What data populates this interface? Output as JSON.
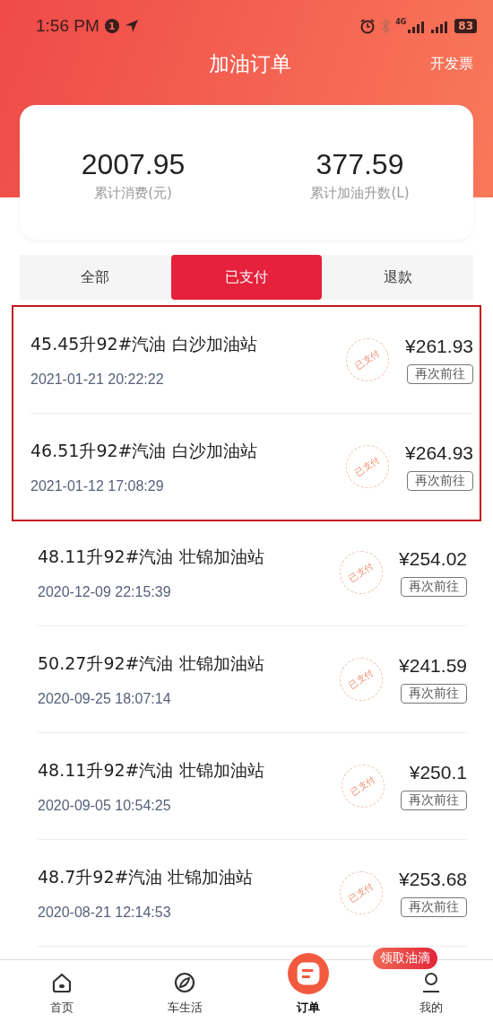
{
  "status_bar": {
    "time": "1:56 PM",
    "notification_count": "1",
    "network": "4G",
    "battery": "83"
  },
  "header": {
    "title": "加油订单",
    "action": "开发票"
  },
  "summary": [
    {
      "value": "2007.95",
      "label": "累计消费(元)"
    },
    {
      "value": "377.59",
      "label": "累计加油升数(L)"
    }
  ],
  "tabs": [
    {
      "label": "全部",
      "selected": false
    },
    {
      "label": "已支付",
      "selected": true
    },
    {
      "label": "退款",
      "selected": false
    }
  ],
  "orders": [
    {
      "title": "45.45升92#汽油 白沙加油站",
      "time": "2021-01-21 20:22:22",
      "stamp": "已支付",
      "price": "¥261.93",
      "button": "再次前往",
      "highlighted": true
    },
    {
      "title": "46.51升92#汽油 白沙加油站",
      "time": "2021-01-12 17:08:29",
      "stamp": "已支付",
      "price": "¥264.93",
      "button": "再次前往",
      "highlighted": true
    },
    {
      "title": "48.11升92#汽油 壮锦加油站",
      "time": "2020-12-09 22:15:39",
      "stamp": "已支付",
      "price": "¥254.02",
      "button": "再次前往",
      "highlighted": false
    },
    {
      "title": "50.27升92#汽油 壮锦加油站",
      "time": "2020-09-25 18:07:14",
      "stamp": "已支付",
      "price": "¥241.59",
      "button": "再次前往",
      "highlighted": false
    },
    {
      "title": "48.11升92#汽油 壮锦加油站",
      "time": "2020-09-05 10:54:25",
      "stamp": "已支付",
      "price": "¥250.1",
      "button": "再次前往",
      "highlighted": false
    },
    {
      "title": "48.7升92#汽油 壮锦加油站",
      "time": "2020-08-21 12:14:53",
      "stamp": "已支付",
      "price": "¥253.68",
      "button": "再次前往",
      "highlighted": false
    }
  ],
  "bottom_nav": {
    "badge": "领取油滴",
    "items": [
      {
        "label": "首页",
        "kind": "home",
        "selected": false
      },
      {
        "label": "车生活",
        "kind": "compass",
        "selected": false
      },
      {
        "label": "订单",
        "kind": "order",
        "selected": true
      },
      {
        "label": "我的",
        "kind": "person",
        "selected": false
      }
    ]
  }
}
